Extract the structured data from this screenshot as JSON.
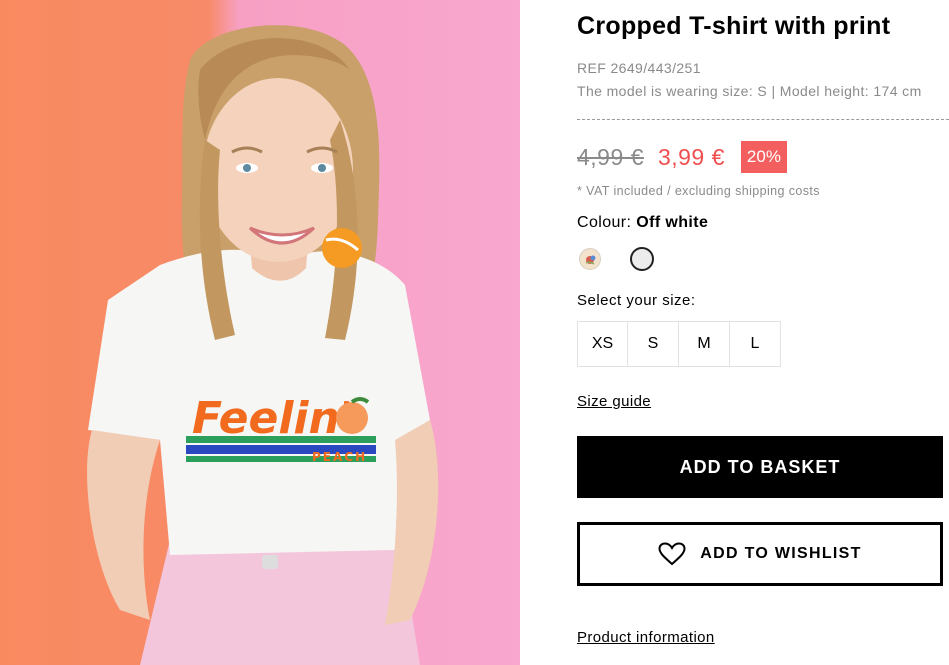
{
  "product": {
    "title": "Cropped T-shirt with print",
    "ref": "REF 2649/443/251",
    "model_info": "The model is wearing size: S | Model height: 174 cm",
    "old_price": "4,99 €",
    "new_price": "3,99 €",
    "discount": "20%",
    "vat_note": "* VAT included / excluding shipping costs",
    "colour_label": "Colour:",
    "colour_value": "Off white",
    "swatches": [
      "printed-swatch-icon",
      "off-white-swatch-icon"
    ],
    "size_label": "Select your size:",
    "sizes": [
      "XS",
      "S",
      "M",
      "L"
    ],
    "size_guide": "Size guide",
    "add_to_basket": "ADD TO BASKET",
    "add_to_wishlist": "ADD TO WISHLIST",
    "product_information": "Product information"
  },
  "photo": {
    "print_text_main": "Feelin'",
    "print_text_sub": "PEACH"
  },
  "colors": {
    "sale_red": "#f04f4f",
    "discount_badge": "#f35f5f",
    "muted_text": "#8a8a8a",
    "background_orange": "#f98a60",
    "background_pink": "#f9a7cf"
  },
  "icons": {
    "wishlist": "heart-icon"
  }
}
